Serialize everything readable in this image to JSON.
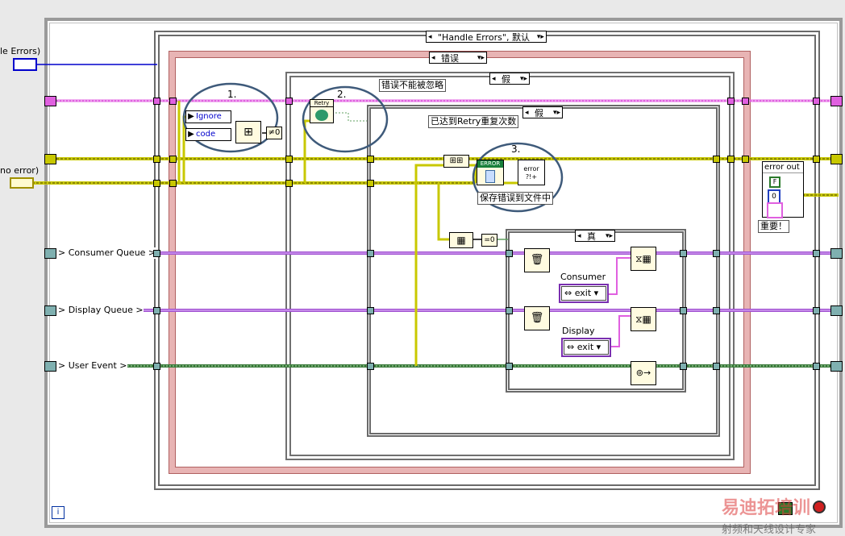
{
  "outer_labels": {
    "handle_errors": "le Errors)",
    "no_error": "no error)",
    "consumer_queue": "> Consumer Queue >",
    "display_queue": "> Display Queue >",
    "user_event": "> User Event >"
  },
  "selectors": {
    "outer_case": "\"Handle Errors\", 默认",
    "error_case": "错误",
    "ignore_case": "假",
    "retry_case": "假",
    "inner_case": "真"
  },
  "case_labels": {
    "cannot_ignore": "错误不能被忽略",
    "retry_reached": "已达到Retry重复次数",
    "save_to_file": "保存错误到文件中"
  },
  "annotations": {
    "one": "1.",
    "two": "2.",
    "three": "3."
  },
  "nodes": {
    "ignore_label": "Ignore",
    "code_label": "code",
    "retry_label": "Retry",
    "error_label": "ERROR",
    "error_dialog_label": "error ?!+"
  },
  "enums": {
    "consumer": {
      "caption": "Consumer",
      "value": "exit"
    },
    "display": {
      "caption": "Display",
      "value": "exit"
    }
  },
  "error_out": {
    "title": "error out",
    "status": "F",
    "code": "0",
    "important": "重要！"
  },
  "info_icon": "i",
  "watermark": {
    "top": "易迪拓培训",
    "bottom": "射频和天线设计专家"
  },
  "colors": {
    "pink_wire": "#e060e0",
    "error_wire": "#c8c800",
    "queue_wire": "#a050d0",
    "event_wire": "#3a7a3a",
    "blue_wire": "#0000cc"
  }
}
